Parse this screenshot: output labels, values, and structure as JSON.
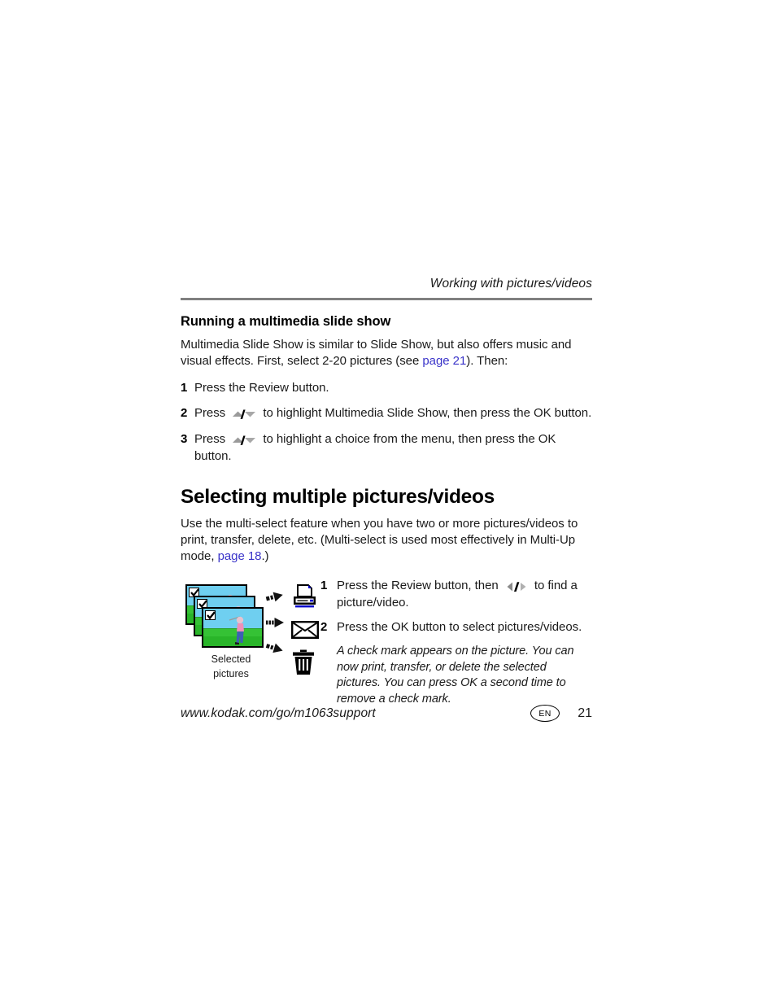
{
  "header": {
    "running_title": "Working with pictures/videos"
  },
  "section_slideshow": {
    "heading": "Running a multimedia slide show",
    "intro_part1": "Multimedia Slide Show is similar to Slide Show, but also offers music and visual effects. First, select 2-20 pictures (see ",
    "intro_link": "page 21",
    "intro_part2": "). Then:",
    "steps": [
      {
        "num": "1",
        "text_before": "Press the Review button.",
        "glyph": "",
        "text_after": ""
      },
      {
        "num": "2",
        "text_before": "Press ",
        "glyph": "up-down-rocker-icon",
        "text_after": " to highlight Multimedia Slide Show, then press the OK button."
      },
      {
        "num": "3",
        "text_before": "Press ",
        "glyph": "up-down-rocker-icon",
        "text_after": " to highlight a choice from the menu, then press the OK button."
      }
    ]
  },
  "section_multiselect": {
    "heading": "Selecting multiple pictures/videos",
    "intro_part1": "Use the multi-select feature when you have two or more pictures/videos to print, transfer, delete, etc. (Multi-select is used most effectively in Multi-Up mode, ",
    "intro_link": "page 18",
    "intro_part2": ".)",
    "illustration": {
      "caption": "Selected\npictures",
      "caption_line1": "Selected",
      "caption_line2": "pictures",
      "photo_count": 3,
      "photo_subject": "golfer",
      "check_mark": "✓",
      "arrows": [
        "arrow-up-right-icon",
        "arrow-right-icon",
        "arrow-down-right-icon"
      ],
      "destinations": [
        "printer-icon",
        "envelope-icon",
        "trash-icon"
      ],
      "colors": {
        "sky": "#6fcff0",
        "grass": "#35c235",
        "printer_accent": "#0000cc",
        "photo_border": "#000000"
      }
    },
    "steps": [
      {
        "num": "1",
        "text_before": "Press the Review button, then ",
        "glyph": "left-right-rocker-icon",
        "text_after": " to find a picture/video."
      },
      {
        "num": "2",
        "text_before": "Press the OK button to select pictures/videos.",
        "glyph": "",
        "text_after": ""
      }
    ],
    "note": "A check mark appears on the picture. You can now print, transfer, or delete the selected pictures. You can press OK a second time to remove a check mark."
  },
  "footer": {
    "url": "www.kodak.com/go/m1063support",
    "language_badge": "EN",
    "page_number": "21"
  },
  "theme": {
    "link_color": "#3a34c9",
    "rule_color": "#808080",
    "text_color": "#1a1a1a"
  }
}
